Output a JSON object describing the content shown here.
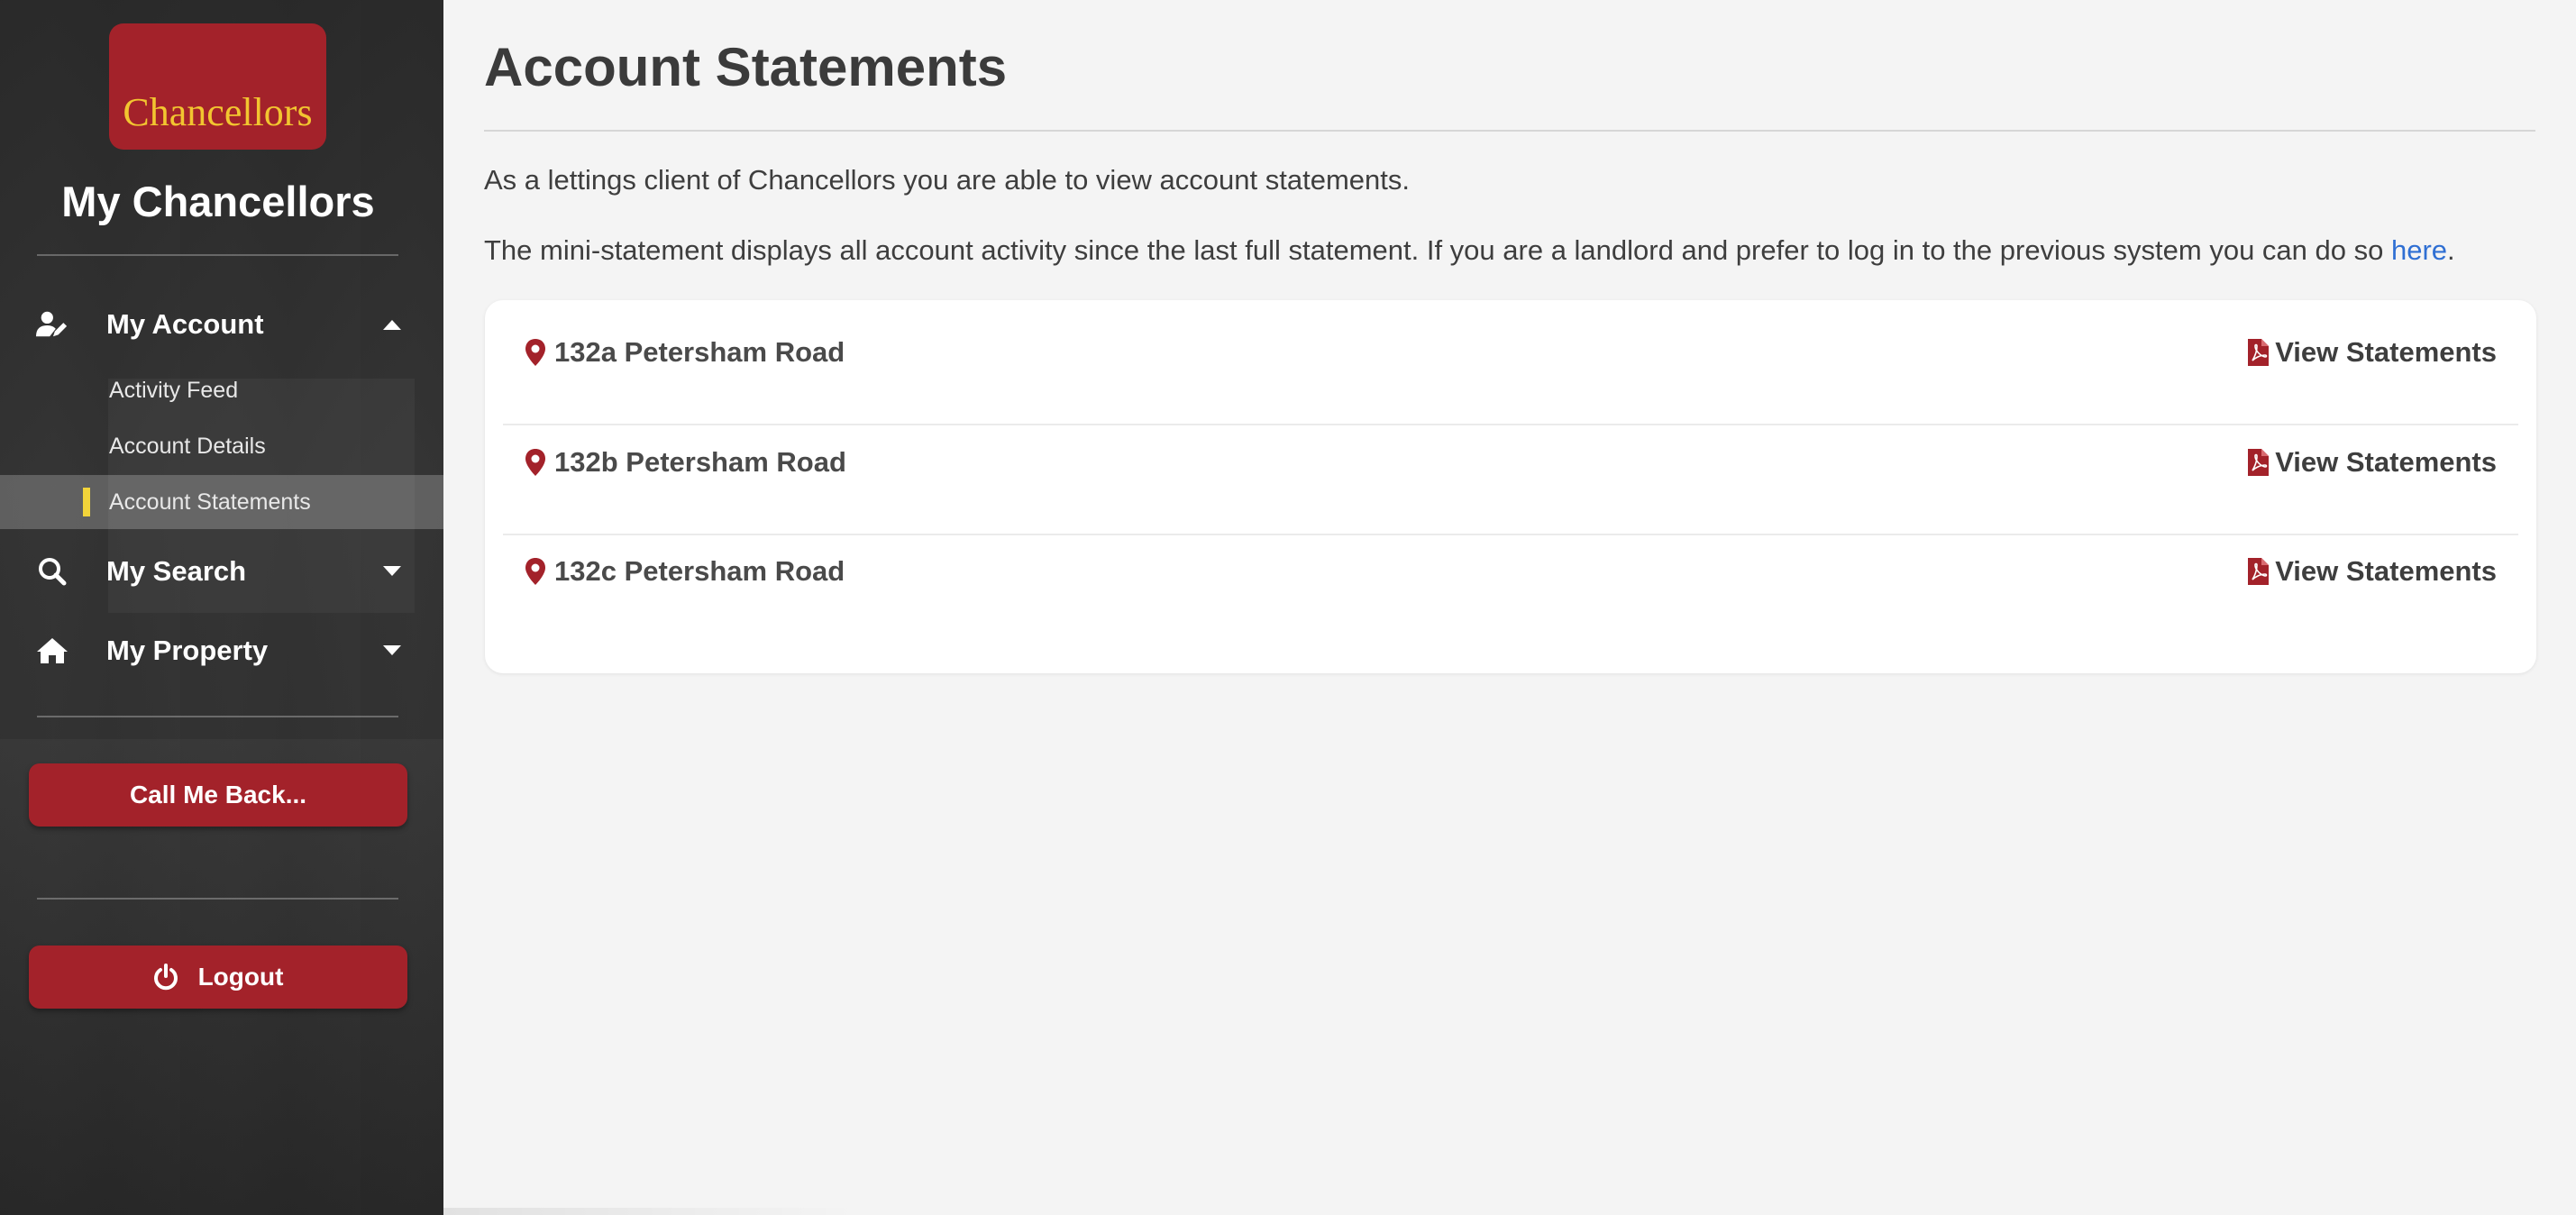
{
  "brand": {
    "logo_text": "Chancellors",
    "title": "My Chancellors"
  },
  "nav": {
    "my_account": {
      "label": "My Account",
      "icon": "user-edit-icon",
      "expanded": true
    },
    "sub_items": [
      {
        "label": "Activity Feed",
        "active": false
      },
      {
        "label": "Account Details",
        "active": false
      },
      {
        "label": "Account Statements",
        "active": true
      }
    ],
    "my_search": {
      "label": "My Search",
      "icon": "search-icon"
    },
    "my_property": {
      "label": "My Property",
      "icon": "home-icon"
    }
  },
  "actions": {
    "call_me_back": "Call Me Back...",
    "logout": "Logout"
  },
  "page": {
    "title": "Account Statements",
    "intro": "As a lettings client of Chancellors you are able to view account statements.",
    "mini_statement_text": "The mini-statement displays all account activity since the last full statement. If you are a landlord and prefer to log in to the previous system you can do so ",
    "link_text": "here",
    "period": "."
  },
  "properties": [
    {
      "address": "132a Petersham Road",
      "action": "View Statements"
    },
    {
      "address": "132b Petersham Road",
      "action": "View Statements"
    },
    {
      "address": "132c Petersham Road",
      "action": "View Statements"
    }
  ],
  "colors": {
    "brand_red": "#a3222a",
    "brand_gold": "#f2c530",
    "active_marker": "#f2d43a",
    "link": "#2f6fd3"
  }
}
